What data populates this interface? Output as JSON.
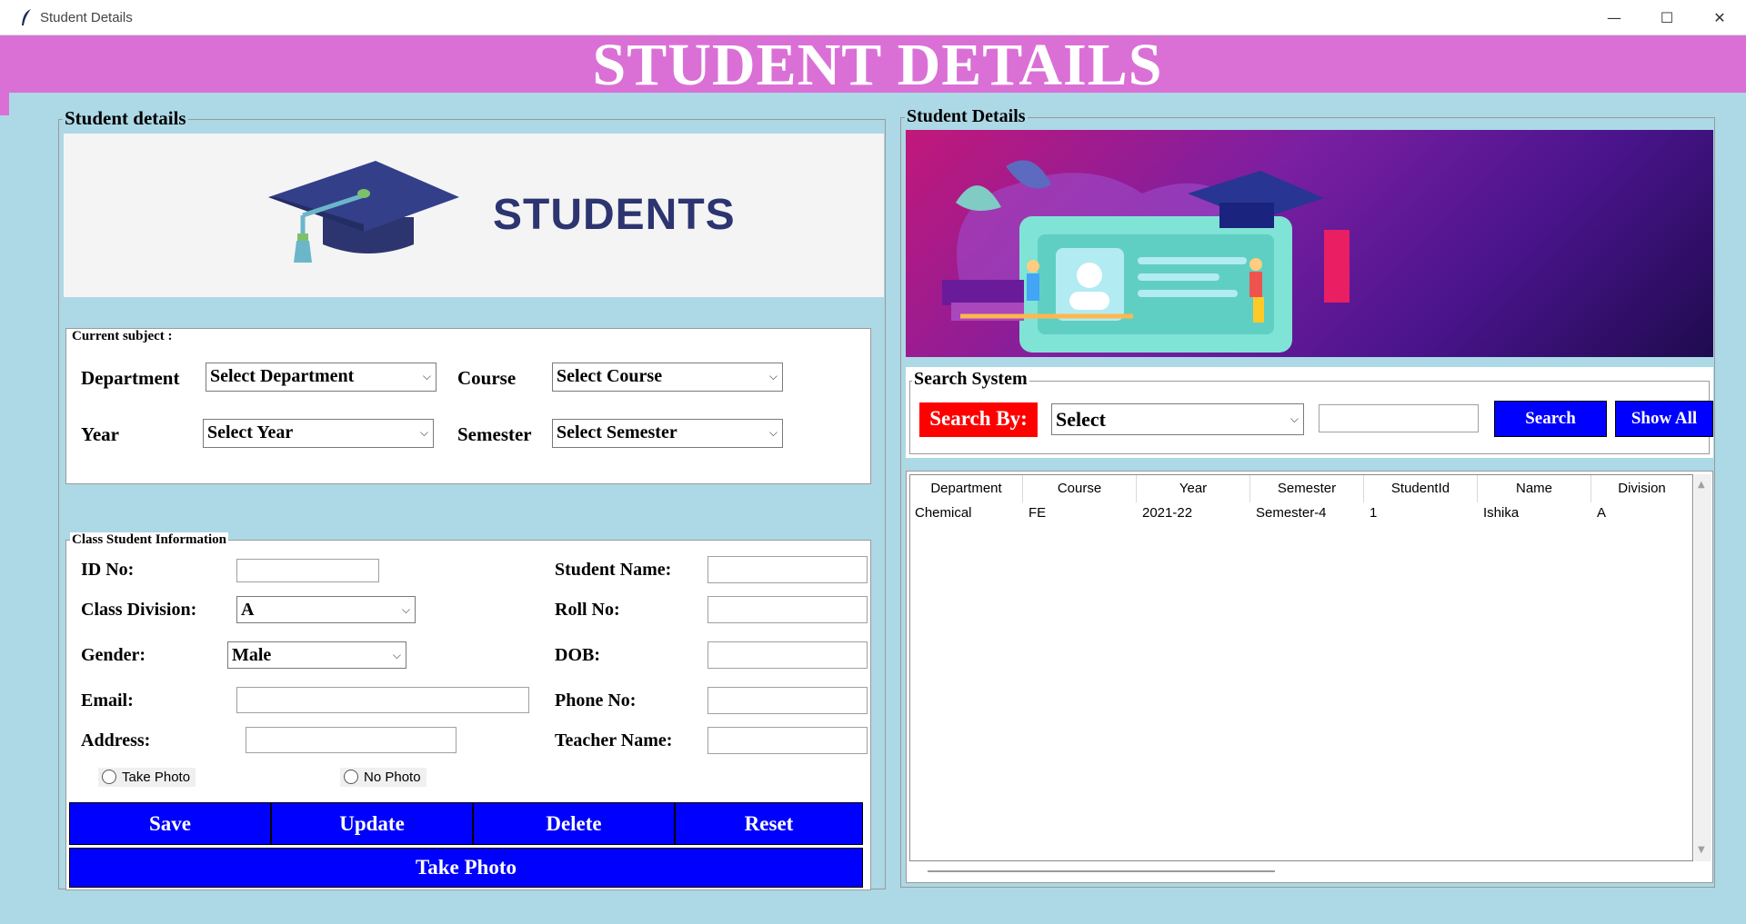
{
  "window": {
    "title": "Student Details",
    "minimize": "—",
    "maximize": "☐",
    "close": "✕"
  },
  "banner": {
    "title": "STUDENT DETAILS"
  },
  "left_panel": {
    "legend": "Student details",
    "logo_text": "STUDENTS",
    "current_subject": {
      "legend": "Current subject :",
      "department_label": "Department",
      "department_value": "Select Department",
      "course_label": "Course",
      "course_value": "Select Course",
      "year_label": "Year",
      "year_value": "Select Year",
      "semester_label": "Semester",
      "semester_value": "Select Semester"
    },
    "class_info": {
      "legend": "Class Student Information",
      "id_label": "ID No:",
      "division_label": "Class Division:",
      "division_value": "A",
      "gender_label": "Gender:",
      "gender_value": "Male",
      "email_label": "Email:",
      "address_label": "Address:",
      "student_name_label": "Student Name:",
      "roll_label": "Roll No:",
      "dob_label": "DOB:",
      "phone_label": "Phone No:",
      "teacher_label": "Teacher Name:",
      "take_photo_radio": "Take Photo",
      "no_photo_radio": "No Photo"
    },
    "buttons": {
      "save": "Save",
      "update": "Update",
      "delete": "Delete",
      "reset": "Reset",
      "take_photo": "Take Photo"
    }
  },
  "right_panel": {
    "legend": "Student Details",
    "search": {
      "legend": "Search System",
      "search_by_label": "Search By:",
      "select_value": "Select",
      "search_button": "Search",
      "show_all_button": "Show All"
    },
    "table": {
      "columns": [
        "Department",
        "Course",
        "Year",
        "Semester",
        "StudentId",
        "Name",
        "Division"
      ],
      "rows": [
        [
          "Chemical",
          "FE",
          "2021-22",
          "Semester-4",
          "1",
          "Ishika",
          "A"
        ]
      ]
    }
  },
  "colors": {
    "background": "#add8e6",
    "banner": "#da70d6",
    "button": "#0000ff",
    "search_label_bg": "#ff0000"
  }
}
